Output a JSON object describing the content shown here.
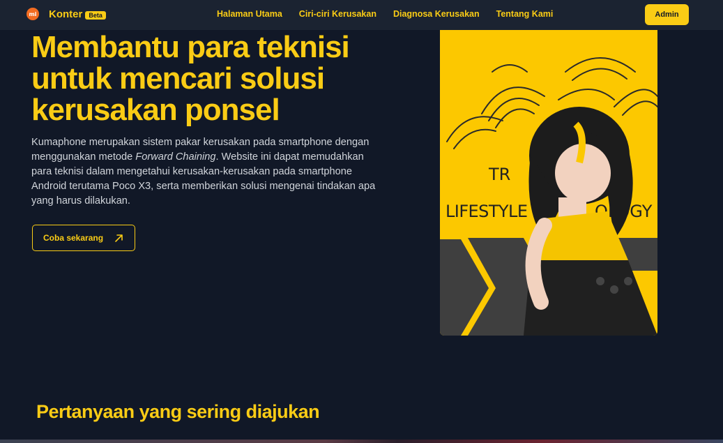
{
  "brand": {
    "logo_text": "mi",
    "name": "Konter",
    "badge": "Beta"
  },
  "nav": {
    "links": [
      {
        "label": "Halaman Utama"
      },
      {
        "label": "Ciri-ciri Kerusakan"
      },
      {
        "label": "Diagnosa Kerusakan"
      },
      {
        "label": "Tentang Kami"
      }
    ],
    "admin_label": "Admin"
  },
  "hero": {
    "title": "Membantu para teknisi untuk mencari solusi kerusakan ponsel",
    "desc_before": "Kumaphone merupakan sistem pakar kerusakan pada smartphone dengan menggunakan metode ",
    "desc_em": "Forward Chaining",
    "desc_after": ". Website ini dapat memudahkan para teknisi dalam mengetahui kerusakan-kerusakan pada smartphone Android terutama Poco X3, serta memberikan solusi mengenai tindakan apa yang harus dilakukan.",
    "cta_label": "Coba sekarang",
    "art_text_line1": "TR",
    "art_text_line2": "LIFESTYLE",
    "art_text_line3": "OLOGY"
  },
  "faq": {
    "title": "Pertanyaan yang sering diajukan"
  },
  "colors": {
    "accent": "#facc15",
    "background": "#111827",
    "navbar": "#1b2331",
    "logo": "#f36c21"
  },
  "icons": {
    "cta": "arrow-up-right-icon"
  }
}
